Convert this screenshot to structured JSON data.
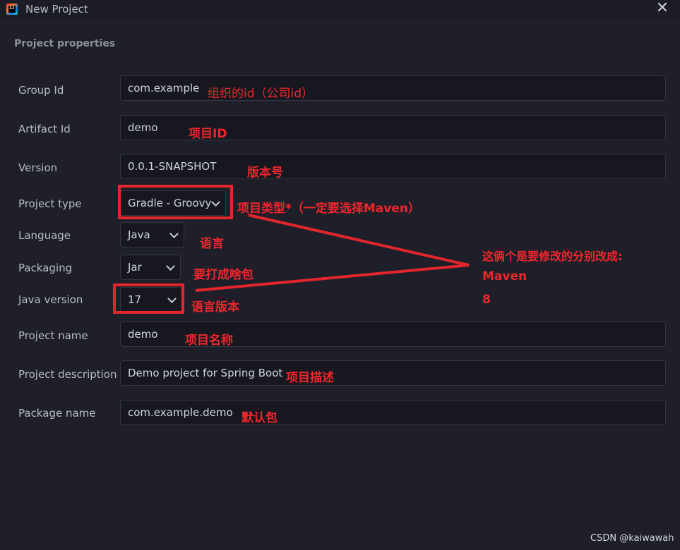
{
  "window": {
    "title": "New Project",
    "close_symbol": "✕"
  },
  "section_title": "Project properties",
  "fields": {
    "group_id": {
      "label": "Group Id",
      "value": "com.example",
      "note": "组织的id（公司id）"
    },
    "artifact_id": {
      "label": "Artifact Id",
      "value": "demo",
      "note": "项目ID"
    },
    "version": {
      "label": "Version",
      "value": "0.0.1-SNAPSHOT",
      "note": "版本号"
    },
    "project_type": {
      "label": "Project type",
      "value": "Gradle - Groovy",
      "note": "项目类型*（一定要选择Maven）"
    },
    "language": {
      "label": "Language",
      "value": "Java",
      "note": "语言"
    },
    "packaging": {
      "label": "Packaging",
      "value": "Jar",
      "note": "要打成啥包"
    },
    "java_version": {
      "label": "Java version",
      "value": "17",
      "note": "语言版本"
    },
    "project_name": {
      "label": "Project name",
      "value": "demo",
      "note": "项目名称"
    },
    "project_description": {
      "label": "Project description",
      "value": "Demo project for Spring Boot",
      "note": "项目描述"
    },
    "package_name": {
      "label": "Package name",
      "value": "com.example.demo",
      "note": "默认包"
    }
  },
  "callout": {
    "line1": "这俩个是要修改的分别改成:",
    "line2": "Maven",
    "line3": "8"
  },
  "watermark": "CSDN @kaiwawah",
  "colors": {
    "annotation": "#f0262d",
    "background": "#1e1f29",
    "field_bg": "#17181f"
  }
}
